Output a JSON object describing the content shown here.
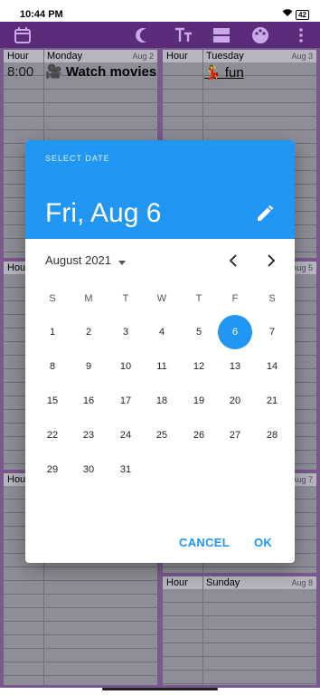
{
  "status_bar": {
    "time": "10:44 PM",
    "battery": "42"
  },
  "app_bar": {
    "icons": [
      "calendar-icon",
      "moon-icon",
      "text-size-icon",
      "layout-icon",
      "palette-icon",
      "more-vert-icon"
    ],
    "background": "#5a2c79"
  },
  "week": {
    "hour_label": "Hour",
    "days": [
      {
        "name": "Monday",
        "date": "Aug 2",
        "first_hour": "8:00",
        "event_emoji": "🎥",
        "event": "Watch movies"
      },
      {
        "name": "Tuesday",
        "date": "Aug 3",
        "event_emoji": "💃",
        "event": "fun"
      },
      {
        "name": "",
        "date": "Aug 5"
      },
      {
        "name": "",
        "date": "Aug 7"
      },
      {
        "name": "Sunday",
        "date": "Aug 8"
      }
    ],
    "partial_labels": [
      "Hou",
      "Hou"
    ]
  },
  "date_picker": {
    "header_caption": "SELECT DATE",
    "selected_date": "Fri, Aug 6",
    "month_label": "August 2021",
    "weekdays": [
      "S",
      "M",
      "T",
      "W",
      "T",
      "F",
      "S"
    ],
    "first_weekday_index": 0,
    "first_day_offset": 0,
    "days": [
      "1",
      "2",
      "3",
      "4",
      "5",
      "6",
      "7",
      "8",
      "9",
      "10",
      "11",
      "12",
      "13",
      "14",
      "15",
      "16",
      "17",
      "18",
      "19",
      "20",
      "21",
      "22",
      "23",
      "24",
      "25",
      "26",
      "27",
      "28",
      "29",
      "30",
      "31"
    ],
    "selected_day": "6",
    "cancel_label": "CANCEL",
    "ok_label": "OK",
    "accent": "#2196f3"
  }
}
